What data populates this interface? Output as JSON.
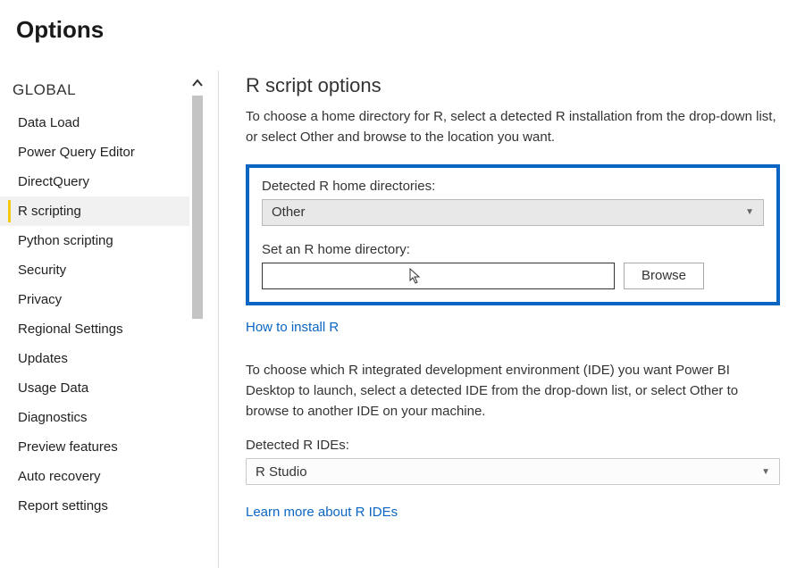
{
  "dialog": {
    "title": "Options"
  },
  "sidebar": {
    "header": "GLOBAL",
    "items": [
      {
        "label": "Data Load"
      },
      {
        "label": "Power Query Editor"
      },
      {
        "label": "DirectQuery"
      },
      {
        "label": "R scripting",
        "active": true
      },
      {
        "label": "Python scripting"
      },
      {
        "label": "Security"
      },
      {
        "label": "Privacy"
      },
      {
        "label": "Regional Settings"
      },
      {
        "label": "Updates"
      },
      {
        "label": "Usage Data"
      },
      {
        "label": "Diagnostics"
      },
      {
        "label": "Preview features"
      },
      {
        "label": "Auto recovery"
      },
      {
        "label": "Report settings"
      }
    ]
  },
  "main": {
    "title": "R script options",
    "desc1": "To choose a home directory for R, select a detected R installation from the drop-down list, or select Other and browse to the location you want.",
    "detected_label": "Detected R home directories:",
    "detected_value": "Other",
    "set_home_label": "Set an R home directory:",
    "home_value": "",
    "browse_label": "Browse",
    "install_link": "How to install R",
    "desc2": "To choose which R integrated development environment (IDE) you want Power BI Desktop to launch, select a detected IDE from the drop-down list, or select Other to browse to another IDE on your machine.",
    "ide_label": "Detected R IDEs:",
    "ide_value": "R Studio",
    "ide_link": "Learn more about R IDEs"
  }
}
